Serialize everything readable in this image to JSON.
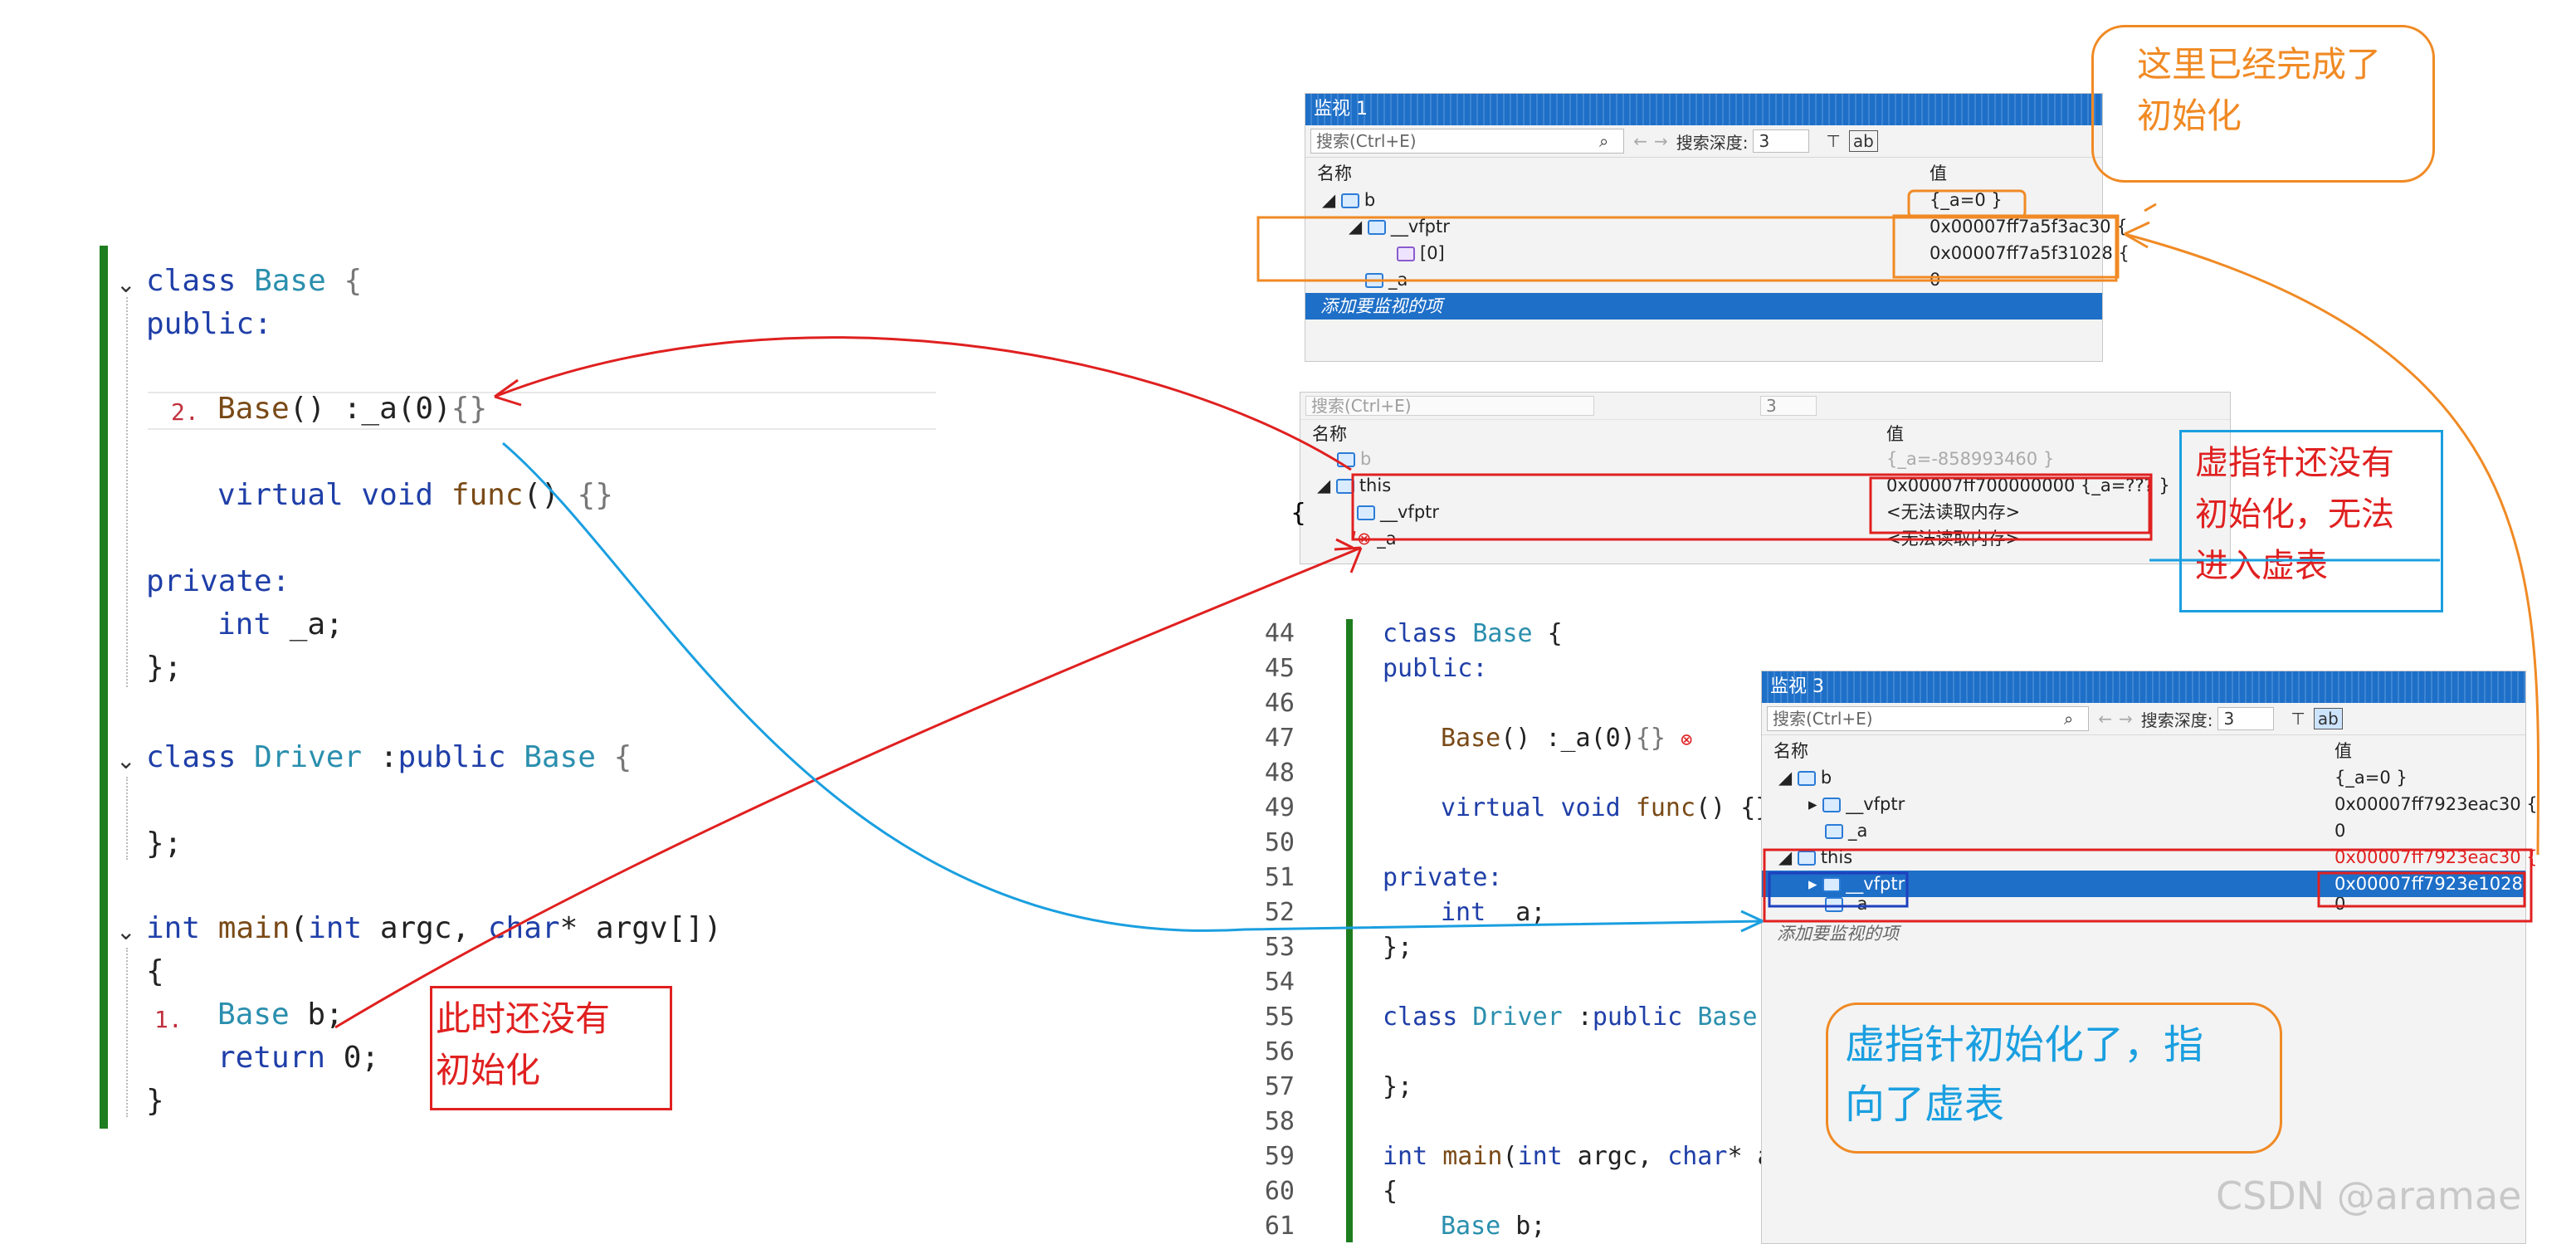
{
  "left_code": {
    "lines": [
      "class Base {",
      "public:",
      "Base() :_a(0){}",
      "virtual void func() {}",
      "private:",
      "int _a;",
      "};",
      "class Driver :public Base {",
      "};",
      "int main(int argc, char* argv[])",
      "{",
      "Base b;",
      "return 0;",
      "}"
    ],
    "marker1": "1.",
    "marker2": "2."
  },
  "watch1": {
    "title": "监视 1",
    "search_placeholder": "搜索(Ctrl+E)",
    "depth_label": "搜索深度:",
    "depth_value": "3",
    "col_name": "名称",
    "col_value": "值",
    "rows": [
      {
        "name": "b",
        "value": "{_a=0 }"
      },
      {
        "name": "__vfptr",
        "value": "0x00007ff7a5f3ac30 {"
      },
      {
        "name": "[0]",
        "value": "0x00007ff7a5f31028 {"
      },
      {
        "name": "_a",
        "value": "0"
      }
    ],
    "add_item": "添加要监视的项"
  },
  "watch2": {
    "search_placeholder": "搜索(Ctrl+E)",
    "depth_value": "3",
    "col_name": "名称",
    "col_value": "值",
    "rows": [
      {
        "name": "b",
        "value": "{_a=-858993460 }"
      },
      {
        "name": "this",
        "value": "0x00007ff700000000 {_a=??? }"
      },
      {
        "name": "__vfptr",
        "value": "<无法读取内存>"
      },
      {
        "name": "_a",
        "value": "<无法读取内存>"
      }
    ],
    "brace": "{"
  },
  "watch3": {
    "title": "监视 3",
    "search_placeholder": "搜索(Ctrl+E)",
    "depth_label": "搜索深度:",
    "depth_value": "3",
    "col_name": "名称",
    "col_value": "值",
    "rows": [
      {
        "name": "b",
        "value": "{_a=0 }"
      },
      {
        "name": "__vfptr",
        "value": "0x00007ff7923eac30 {"
      },
      {
        "name": "_a",
        "value": "0"
      },
      {
        "name": "this",
        "value": "0x00007ff7923eac30 {"
      },
      {
        "name": "__vfptr",
        "value": "0x00007ff7923e1028 {"
      },
      {
        "name": "_a",
        "value": "0"
      }
    ],
    "add_item": "添加要监视的项"
  },
  "right_code": {
    "line_numbers": [
      "44",
      "45",
      "46",
      "47",
      "48",
      "49",
      "50",
      "51",
      "52",
      "53",
      "54",
      "55",
      "56",
      "57",
      "58",
      "59",
      "60",
      "61"
    ],
    "lines": [
      "class Base {",
      "public:",
      "",
      "Base() :_a(0){}",
      "",
      "virtual void func() {}",
      "",
      "private:",
      "int _a;",
      "};",
      "",
      "class Driver :public Base",
      "",
      "};",
      "",
      "int main(int argc, char* a",
      "{",
      "Base b;"
    ]
  },
  "annotations": {
    "top_right": "这里已经完成了\n初始化",
    "middle_right": "虚指针还没有\n初始化，无法\n进入虚表",
    "bottom_left": "此时还没有\n初始化",
    "bottom_right": "虚指针初始化了，指\n向了虚表"
  },
  "watermark": "CSDN @aramae",
  "colors": {
    "red": "#e02020",
    "orange": "#f08a24",
    "blue": "#1a9fe0",
    "green": "#1e7d1e",
    "vs_blue": "#1e6fc7"
  }
}
